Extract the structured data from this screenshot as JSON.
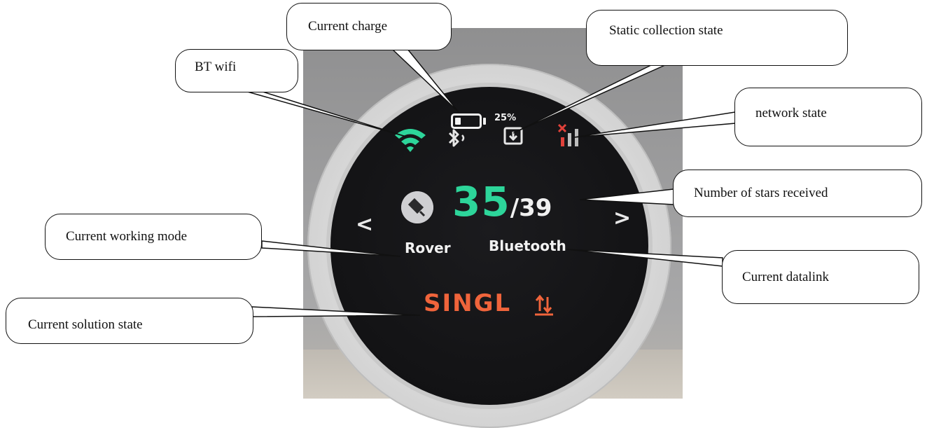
{
  "device": {
    "battery_percent_text": "25%",
    "battery_level": 0.25,
    "satellites_received": "35",
    "satellites_separator": "/",
    "satellites_total": "39",
    "working_mode": "Rover",
    "datalink": "Bluetooth",
    "solution_state": "SINGL",
    "nav_left": "<",
    "nav_right": ">",
    "colors": {
      "wifi": "#2dd59a",
      "satellites": "#2dd59a",
      "solution": "#f0643b",
      "network_error": "#e0413a"
    },
    "icons": [
      "battery-icon",
      "wifi-icon",
      "bluetooth-icon",
      "static-collection-icon",
      "network-signal-icon",
      "working-mode-icon",
      "data-transfer-icon"
    ]
  },
  "callouts": {
    "current_charge": "Current charge",
    "static_collection_state": "Static collection state",
    "bt_wifi": "BT wifi",
    "network_state": "network state",
    "number_of_stars": "Number of stars received",
    "current_working_mode": "Current working mode",
    "current_datalink": "Current datalink",
    "current_solution_state": "Current solution state"
  }
}
